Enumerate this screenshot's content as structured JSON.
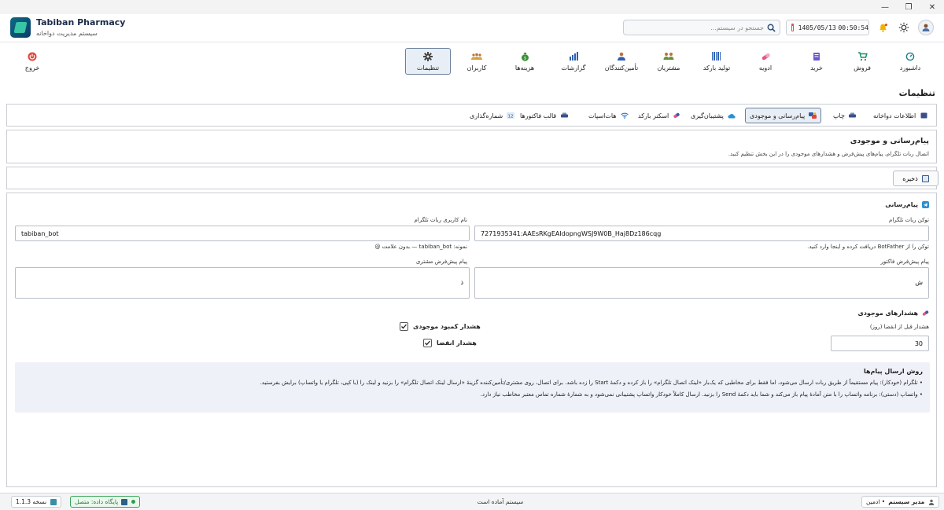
{
  "window": {
    "restore_icon": "restore-icon",
    "minimize_icon": "minimize-icon",
    "close_icon": "close-icon"
  },
  "app": {
    "title": "Tabiban Pharmacy",
    "subtitle": "سیستم مدیریت دواخانه"
  },
  "header": {
    "search_placeholder": "جستجو در سیستم...",
    "date": "1405/05/13",
    "time": "00:50:54"
  },
  "nav": {
    "items": [
      {
        "label": "داشبورد",
        "icon": "dashboard-icon"
      },
      {
        "label": "فروش",
        "icon": "cart-icon"
      },
      {
        "label": "خرید",
        "icon": "purchase-icon"
      },
      {
        "label": "ادویه",
        "icon": "pill-icon"
      },
      {
        "label": "تولید بارکد",
        "icon": "barcode-icon"
      },
      {
        "label": "مشتریان",
        "icon": "customers-icon"
      },
      {
        "label": "تأمین‌کنندگان",
        "icon": "supplier-icon"
      },
      {
        "label": "گزارشات",
        "icon": "chart-icon"
      },
      {
        "label": "هزینه‌ها",
        "icon": "money-bag-icon"
      },
      {
        "label": "کاربران",
        "icon": "users-icon"
      },
      {
        "label": "تنظیمات",
        "icon": "gear-icon"
      }
    ],
    "logout": "خروج"
  },
  "page": {
    "title": "تنظیمات"
  },
  "tabs": [
    "اطلاعات دواخانه",
    "چاپ",
    "پیام‌رسانی و موجودی",
    "پشتیبان‌گیری",
    "اسکنر بارکد",
    "هات‌اسپات",
    "قالب فاکتورها",
    "شماره‌گذاری"
  ],
  "section": {
    "title": "پیام‌رسانی و موجودی",
    "description": "اتصال ربات تلگرام، پیام‌های پیش‌فرض و هشدارهای موجودی را در این بخش تنظیم کنید."
  },
  "toolbar": {
    "save_label": "ذخیره"
  },
  "messaging": {
    "heading": "پیام‌رسانی",
    "token_label": "توکن ربات تلگرام",
    "token_value": "7271935341:AAEsRKgEAIdopngWSJ9W0B_Haj8Dz186cqg",
    "token_hint": "توکن را از BotFather دریافت کرده و اینجا وارد کنید.",
    "username_label": "نام کاربری ربات تلگرام",
    "username_value": "tabiban_bot",
    "username_hint": "نمونه: tabiban_bot — بدون علامت @",
    "invoice_msg_label": "پیام پیش‌فرض فاکتور",
    "invoice_msg_value": "ش",
    "customer_msg_label": "پیام پیش‌فرض مشتری",
    "customer_msg_value": "ذ"
  },
  "inventory": {
    "heading": "هشدارهای موجودی",
    "expiry_label": "هشدار قبل از انقضا (روز)",
    "expiry_value": "30",
    "low_stock_label": "هشدار کمبود موجودی",
    "low_stock_checked": true,
    "expiry_alert_label": "هشدار انقضا",
    "expiry_alert_checked": true
  },
  "info": {
    "title": "روش ارسال پیام‌ها",
    "line1": "• تلگرام (خودکار): پیام مستقیماً از طریق ربات ارسال می‌شود، اما فقط برای مخاطبی که یک‌بار «لینک اتصال تلگرام» را باز کرده و دکمهٔ Start را زده باشد. برای اتصال، روی مشتری/تأمین‌کننده گزینهٔ «ارسال لینک اتصال تلگرام» را بزنید و لینک را (با کپی، تلگرام یا واتساپ) برایش بفرستید.",
    "line2": "• واتساپ (دستی): برنامه واتساپ را با متن آمادهٔ پیام باز می‌کند و شما باید دکمهٔ Send را بزنید. ارسال کاملاً خودکار واتساپ پشتیبانی نمی‌شود و به شمارهٔ شماره تماس معتبر مخاطب نیاز دارد."
  },
  "status": {
    "version": "نسخه 1.1.3",
    "db": "پایگاه داده: متصل",
    "message": "سیستم آماده است",
    "user_name": "مدیر سیستم",
    "user_role": "• ادمین"
  },
  "colors": {
    "accent": "#1a2b48",
    "active_bg": "#e8eef6",
    "db_ok": "#2c9e4c",
    "logout": "#e0463a"
  }
}
